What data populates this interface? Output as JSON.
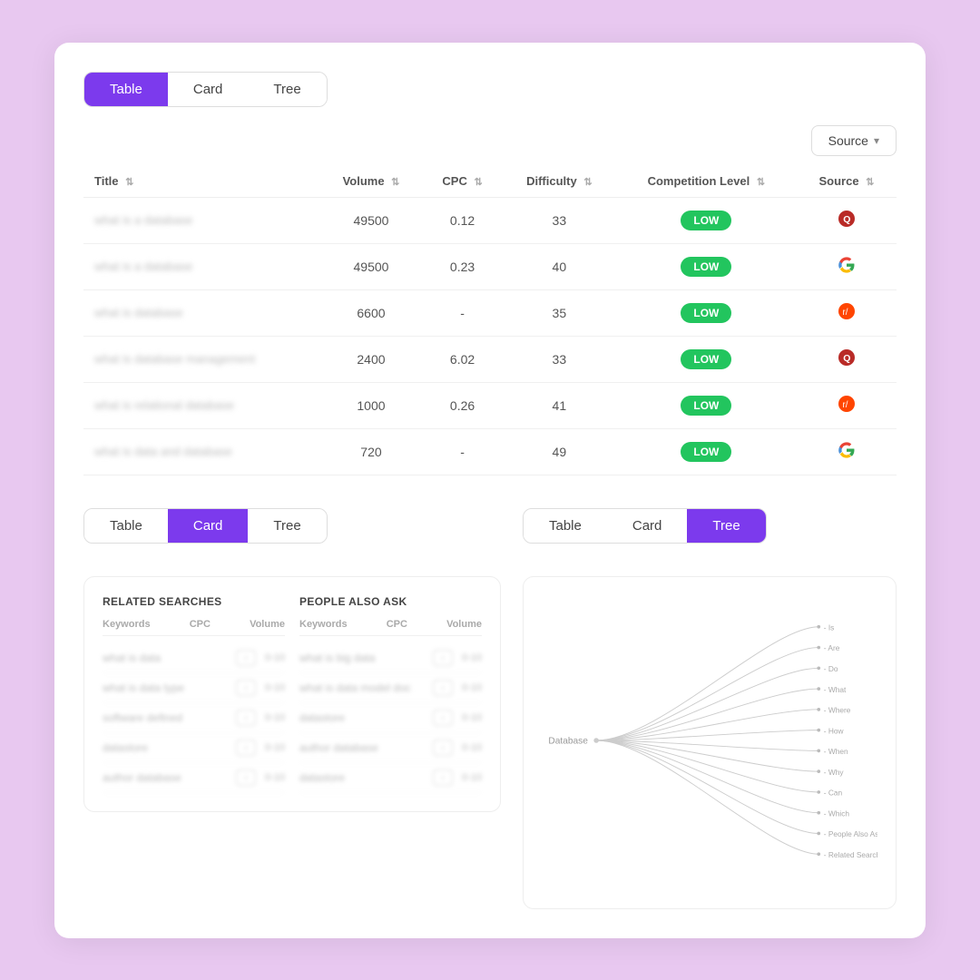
{
  "topTabs": {
    "items": [
      {
        "label": "Table",
        "active": true
      },
      {
        "label": "Card",
        "active": false
      },
      {
        "label": "Tree",
        "active": false
      }
    ]
  },
  "sourceButton": {
    "label": "Source"
  },
  "table": {
    "columns": [
      {
        "label": "Title"
      },
      {
        "label": "Volume"
      },
      {
        "label": "CPC"
      },
      {
        "label": "Difficulty"
      },
      {
        "label": "Competition Level"
      },
      {
        "label": "Source"
      }
    ],
    "rows": [
      {
        "title": "what is a database",
        "volume": "49500",
        "cpc": "0.12",
        "difficulty": "33",
        "competition": "LOW",
        "source": "quora"
      },
      {
        "title": "what is a database",
        "volume": "49500",
        "cpc": "0.23",
        "difficulty": "40",
        "competition": "LOW",
        "source": "google"
      },
      {
        "title": "what is database",
        "volume": "6600",
        "cpc": "-",
        "difficulty": "35",
        "competition": "LOW",
        "source": "reddit"
      },
      {
        "title": "what is database management",
        "volume": "2400",
        "cpc": "6.02",
        "difficulty": "33",
        "competition": "LOW",
        "source": "quora"
      },
      {
        "title": "what is relational database",
        "volume": "1000",
        "cpc": "0.26",
        "difficulty": "41",
        "competition": "LOW",
        "source": "reddit"
      },
      {
        "title": "what is data and database",
        "volume": "720",
        "cpc": "-",
        "difficulty": "49",
        "competition": "LOW",
        "source": "google"
      }
    ]
  },
  "bottomLeftTabs": {
    "items": [
      {
        "label": "Table",
        "active": false
      },
      {
        "label": "Card",
        "active": true
      },
      {
        "label": "Tree",
        "active": false
      }
    ]
  },
  "cardPanel": {
    "sections": [
      {
        "title": "RELATED SEARCHES",
        "rows": [
          {
            "keyword": "what is data",
            "cpc": "-",
            "volume": "0-10"
          },
          {
            "keyword": "what is data type",
            "cpc": "-",
            "volume": "0-10"
          },
          {
            "keyword": "software defined",
            "cpc": "-",
            "volume": "0-10"
          },
          {
            "keyword": "datastore",
            "cpc": "-",
            "volume": "0-10"
          },
          {
            "keyword": "author database",
            "cpc": "-",
            "volume": "0-10"
          }
        ]
      },
      {
        "title": "PEOPLE ALSO ASK",
        "rows": [
          {
            "keyword": "what is big data",
            "cpc": "-",
            "volume": "0-10"
          },
          {
            "keyword": "what is data model doc",
            "cpc": "-",
            "volume": "0-10"
          },
          {
            "keyword": "datastore",
            "cpc": "-",
            "volume": "0-10"
          },
          {
            "keyword": "author database",
            "cpc": "-",
            "volume": "0-10"
          },
          {
            "keyword": "datastore",
            "cpc": "-",
            "volume": "0-10"
          }
        ]
      }
    ],
    "colHeaders": {
      "keyword": "Keywords",
      "cpc": "CPC",
      "volume": "Volume"
    }
  },
  "bottomRightTabs": {
    "items": [
      {
        "label": "Table",
        "active": false
      },
      {
        "label": "Card",
        "active": false
      },
      {
        "label": "Tree",
        "active": true
      }
    ]
  },
  "tree": {
    "rootLabel": "Database",
    "branches": [
      "Is",
      "Are",
      "Do",
      "What",
      "Where",
      "How",
      "When",
      "Why",
      "Can",
      "Which",
      "People Also Ask",
      "Related Searches"
    ]
  }
}
